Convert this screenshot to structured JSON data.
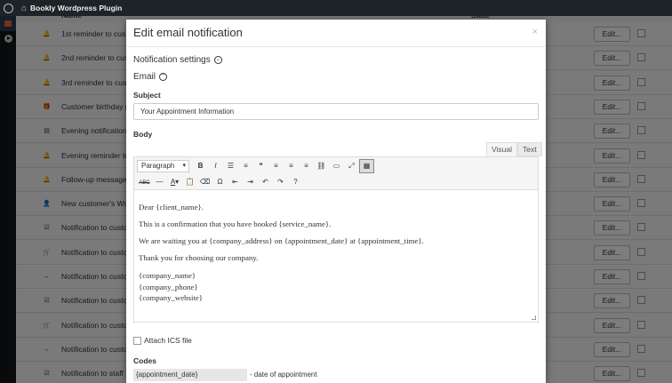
{
  "adminbar": {
    "wp_icon": "wordpress-icon",
    "home_icon": "home-icon",
    "site_name": "Bookly Wordpress Plugin"
  },
  "table": {
    "header_name": "Name",
    "header_state": "State",
    "edit_label": "Edit...",
    "rows": [
      {
        "icon": "bell-icon",
        "name": "1st reminder to cus"
      },
      {
        "icon": "bell-icon",
        "name": "2nd reminder to cust"
      },
      {
        "icon": "bell-icon",
        "name": "3rd reminder to cust"
      },
      {
        "icon": "gift-icon",
        "name": "Customer birthday g"
      },
      {
        "icon": "list-icon",
        "name": "Evening notification"
      },
      {
        "icon": "bell-icon",
        "name": "Evening reminder to"
      },
      {
        "icon": "bell-icon",
        "name": "Follow-up message"
      },
      {
        "icon": "user-plus-icon",
        "name": "New customer's Wo"
      },
      {
        "icon": "calendar-check-icon",
        "name": "Notification to custo"
      },
      {
        "icon": "cart-icon",
        "name": "Notification to custo"
      },
      {
        "icon": "arrows-h-icon",
        "name": "Notification to custo"
      },
      {
        "icon": "calendar-check-icon",
        "name": "Notification to custo"
      },
      {
        "icon": "cart-icon",
        "name": "Notification to custo"
      },
      {
        "icon": "arrows-h-icon",
        "name": "Notification to custo"
      },
      {
        "icon": "calendar-check-icon",
        "name": "Notification to staff"
      }
    ]
  },
  "modal": {
    "title": "Edit email notification",
    "close": "×",
    "notification_settings": "Notification settings",
    "email_section": "Email",
    "subject_label": "Subject",
    "subject_value": "Your Appointment Information",
    "body_label": "Body",
    "tab_visual": "Visual",
    "tab_text": "Text",
    "format_select": "Paragraph",
    "body_paragraphs": [
      "Dear {client_name}.",
      "This is a confirmation that you have booked {service_name}.",
      "We are waiting you at {company_address} on {appointment_date} at {appointment_time}.",
      "Thank you for choosing our company."
    ],
    "signature_lines": [
      "{company_name}",
      "{company_phone}",
      "{company_website}"
    ],
    "attach_ics": "Attach ICS file",
    "codes_label": "Codes",
    "codes": [
      {
        "code": "{appointment_date}",
        "desc": "- date of appointment"
      }
    ]
  }
}
